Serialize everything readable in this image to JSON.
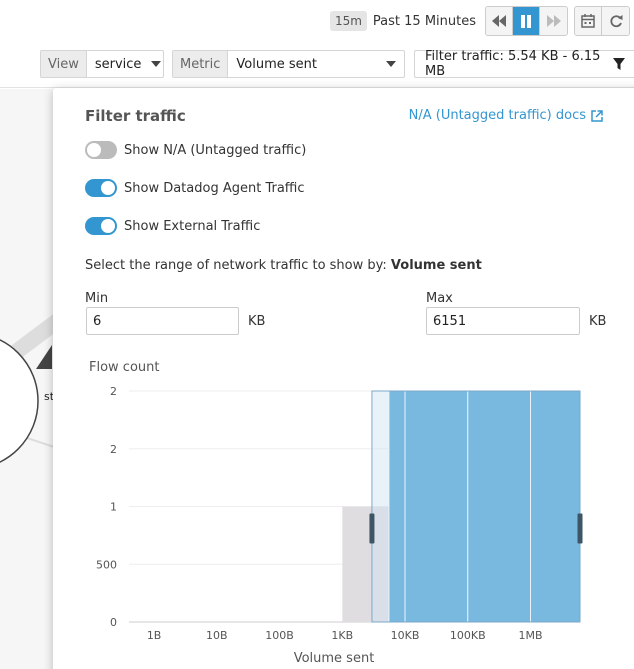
{
  "timebar": {
    "badge": "15m",
    "label": "Past 15 Minutes",
    "buttons": [
      "rewind-icon",
      "pause-icon",
      "fast-forward-icon",
      "calendar-icon",
      "refresh-icon"
    ]
  },
  "filters": {
    "view_label": "View",
    "view_value": "service",
    "metric_label": "Metric",
    "metric_value": "Volume sent",
    "filter_traffic": "Filter traffic: 5.54 KB - 6.15 MB"
  },
  "popover": {
    "title": "Filter traffic",
    "doc_link": "N/A (Untagged traffic) docs",
    "toggles": [
      {
        "label": "Show N/A (Untagged traffic)",
        "on": false
      },
      {
        "label": "Show Datadog Agent Traffic",
        "on": true
      },
      {
        "label": "Show External Traffic",
        "on": true
      }
    ],
    "range_prefix": "Select the range of network traffic to show by:",
    "range_metric": "Volume sent",
    "min_label": "Min",
    "min_value": "6",
    "min_unit": "KB",
    "max_label": "Max",
    "max_value": "6151",
    "max_unit": "KB"
  },
  "background": {
    "node_label": "st"
  },
  "colors": {
    "accent": "#3396d0",
    "unselected_bar": "#e0dde1",
    "selection_fill": "#cfe3f1"
  },
  "chart_data": {
    "type": "bar",
    "title": "Flow count",
    "xlabel": "Volume sent",
    "ylabel": "Flow count",
    "x_ticks": [
      "1B",
      "10B",
      "100B",
      "1KB",
      "10KB",
      "100KB",
      "1MB"
    ],
    "y_ticks": [
      "0",
      "500",
      "1",
      "2",
      "2"
    ],
    "ylim": [
      0,
      2000
    ],
    "bins": [
      {
        "x_from": "1KB",
        "x_to": "5.54KB",
        "value": 1000,
        "selected": false
      },
      {
        "x_from": "5.54KB",
        "x_to": "10KB",
        "value": 2000,
        "selected": true
      },
      {
        "x_from": "10KB",
        "x_to": "100KB",
        "value": 2000,
        "selected": true
      },
      {
        "x_from": "100KB",
        "x_to": "1MB",
        "value": 2000,
        "selected": true
      },
      {
        "x_from": "1MB",
        "x_to": "6.15MB",
        "value": 2000,
        "selected": true
      }
    ],
    "selection": {
      "from": "5.54KB",
      "to": "6.15MB"
    }
  }
}
